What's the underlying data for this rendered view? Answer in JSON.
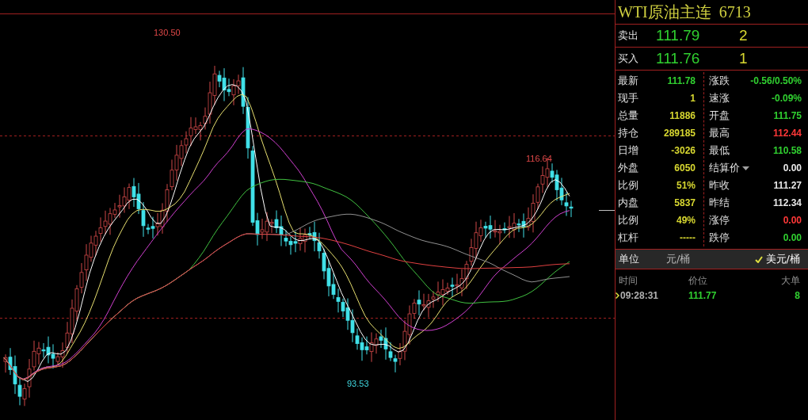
{
  "chart": {
    "labels": [
      {
        "kind": "high",
        "text": "130.50",
        "color": "#e04848"
      },
      {
        "kind": "recent_high",
        "text": "116.64",
        "color": "#e04848"
      },
      {
        "kind": "low",
        "text": "93.53",
        "color": "#40d8e0"
      }
    ]
  },
  "quote": {
    "name": "WTI原油主连",
    "code": "6713",
    "book": [
      {
        "label": "卖出",
        "price": "111.79",
        "volume": "2"
      },
      {
        "label": "买入",
        "price": "111.76",
        "volume": "1"
      }
    ],
    "stats_left": [
      {
        "label": "最新",
        "value": "111.78",
        "color": "#30d030"
      },
      {
        "label": "现手",
        "value": "1",
        "color": "#d8d830"
      },
      {
        "label": "总量",
        "value": "11886",
        "color": "#d8d830"
      },
      {
        "label": "持仓",
        "value": "289185",
        "color": "#d8d830"
      },
      {
        "label": "日增",
        "value": "-3026",
        "color": "#d8d830"
      },
      {
        "label": "外盘",
        "value": "6050",
        "color": "#d8d830"
      },
      {
        "label": "比例",
        "value": "51%",
        "color": "#d8d830"
      },
      {
        "label": "内盘",
        "value": "5837",
        "color": "#d8d830"
      },
      {
        "label": "比例",
        "value": "49%",
        "color": "#d8d830"
      },
      {
        "label": "杠杆",
        "value": "-----",
        "color": "#d8d830"
      }
    ],
    "stats_right": [
      {
        "label": "涨跌",
        "value": "-0.56/0.50%",
        "color": "#30d030",
        "dropdown": false
      },
      {
        "label": "速涨",
        "value": "-0.09%",
        "color": "#30d030",
        "dropdown": false
      },
      {
        "label": "开盘",
        "value": "111.75",
        "color": "#30d030",
        "dropdown": false
      },
      {
        "label": "最高",
        "value": "112.44",
        "color": "#ff3838",
        "dropdown": false
      },
      {
        "label": "最低",
        "value": "110.58",
        "color": "#30d030",
        "dropdown": false
      },
      {
        "label": "结算价",
        "value": "0.00",
        "color": "#e8e8e8",
        "dropdown": true
      },
      {
        "label": "昨收",
        "value": "111.27",
        "color": "#e8e8e8",
        "dropdown": false
      },
      {
        "label": "昨结",
        "value": "112.34",
        "color": "#e8e8e8",
        "dropdown": false
      },
      {
        "label": "涨停",
        "value": "0.00",
        "color": "#ff3838",
        "dropdown": false
      },
      {
        "label": "跌停",
        "value": "0.00",
        "color": "#30d030",
        "dropdown": false
      }
    ],
    "unit": {
      "label": "单位",
      "options": [
        {
          "text": "元/桶",
          "selected": false
        },
        {
          "text": "美元/桶",
          "selected": true
        }
      ]
    },
    "ticks": {
      "columns": [
        "时间",
        "价位",
        "大单"
      ],
      "rows": [
        {
          "time": "09:28:31",
          "price": "111.77",
          "size": "8",
          "latest": true
        }
      ]
    }
  }
}
